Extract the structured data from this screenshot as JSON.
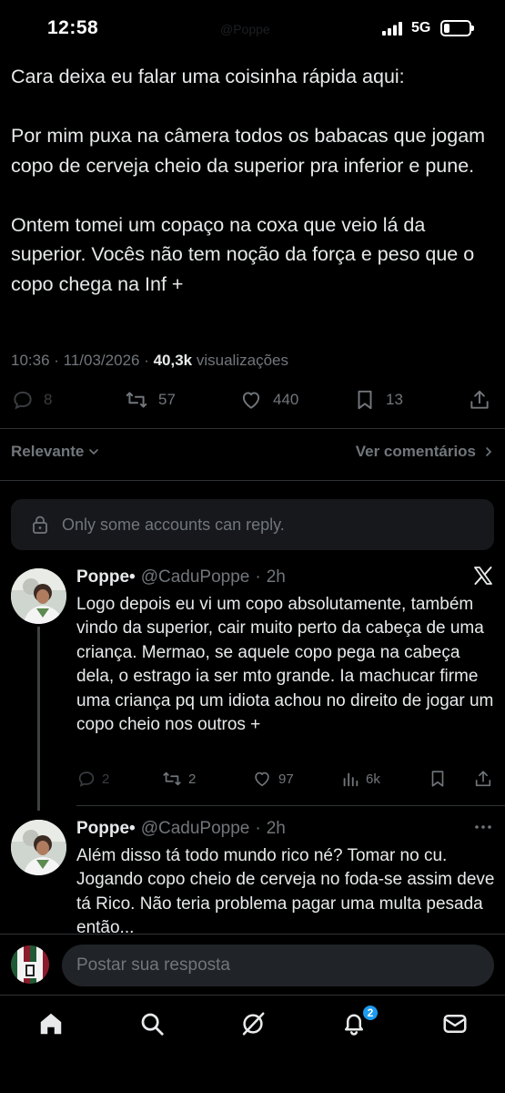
{
  "status_bar": {
    "time": "12:58",
    "network": "5G",
    "ghost_text": "@Poppe"
  },
  "tweet": {
    "paragraphs": [
      "Cara deixa eu falar uma coisinha rápida aqui:",
      "Por mim puxa na câmera todos os babacas que jogam copo de cerveja cheio da superior pra inferior e pune.",
      "Ontem tomei um copaço na coxa que veio lá da superior. Vocês não tem noção da força e peso que o copo chega na Inf +"
    ],
    "time": "10:36",
    "date": "11/03/2026",
    "views_count": "40,3k",
    "views_label": "visualizações",
    "replies": "8",
    "reposts": "57",
    "likes": "440",
    "bookmarks": "13"
  },
  "sort": {
    "label": "Relevante",
    "view_comments": "Ver comentários"
  },
  "reply_notice": "Only some accounts can reply.",
  "replies": [
    {
      "name": "Poppe•",
      "handle": "@CaduPoppe",
      "time": "2h",
      "text": "Logo depois eu vi um copo absolutamente, também vindo da superior, cair muito perto da cabeça de uma criança. Mermao, se aquele copo pega na cabeça dela, o estrago ia ser mto grande. Ia machucar firme uma criança pq um idiota achou no direito de jogar um copo cheio nos outros +",
      "replies": "2",
      "reposts": "2",
      "likes": "97",
      "views": "6k"
    },
    {
      "name": "Poppe•",
      "handle": "@CaduPoppe",
      "time": "2h",
      "text": "Além disso tá todo mundo rico né? Tomar no cu. Jogando copo cheio de cerveja no foda-se assim deve tá Rico. Não teria problema pagar uma multa pesada então..."
    }
  ],
  "compose": {
    "placeholder": "Postar sua resposta"
  },
  "tabbar": {
    "notifications_badge": "2"
  },
  "colors": {
    "background": "#000000",
    "text": "#e7e9ea",
    "muted": "#71767b",
    "accent": "#1d9bf0",
    "divider": "#2f3336"
  }
}
